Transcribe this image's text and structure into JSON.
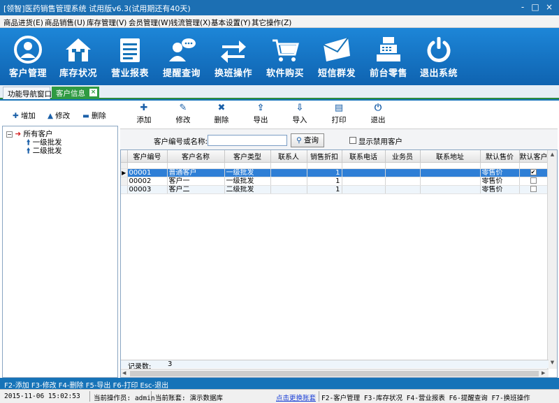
{
  "window": {
    "title": "[领智]医药销售管理系统 试用版v6.3(试用期还有40天)",
    "controls": [
      "-",
      "□",
      "×"
    ]
  },
  "menu": [
    "商品进货(E)",
    "商品销售(U)",
    "库存管理(V)",
    "会员管理(W)",
    "钱流管理(X)",
    "基本设置(Y)",
    "其它操作(Z)"
  ],
  "toolbar": [
    {
      "label": "客户管理",
      "icon": "person-icon"
    },
    {
      "label": "库存状况",
      "icon": "house-icon"
    },
    {
      "label": "营业报表",
      "icon": "report-icon"
    },
    {
      "label": "提醒查询",
      "icon": "chat-user-icon"
    },
    {
      "label": "换班操作",
      "icon": "swap-arrows-icon"
    },
    {
      "label": "软件购买",
      "icon": "cart-icon"
    },
    {
      "label": "短信群发",
      "icon": "envelope-icon"
    },
    {
      "label": "前台零售",
      "icon": "cash-register-icon"
    },
    {
      "label": "退出系统",
      "icon": "power-icon"
    }
  ],
  "tabs": {
    "nav": "功能导航窗口",
    "customer": "客户信息",
    "close": "×"
  },
  "left_actions": {
    "add": "增加",
    "edit": "修改",
    "delete": "删除"
  },
  "tree": {
    "root": "所有客户",
    "children": [
      "一级批发",
      "二级批发"
    ]
  },
  "actions": [
    {
      "label": "添加",
      "icon": "plus-icon",
      "glyph": "✚"
    },
    {
      "label": "修改",
      "icon": "pencil-icon",
      "glyph": "✎"
    },
    {
      "label": "删除",
      "icon": "x-icon",
      "glyph": "✖"
    },
    {
      "label": "导出",
      "icon": "export-icon",
      "glyph": "⇪"
    },
    {
      "label": "导入",
      "icon": "import-icon",
      "glyph": "⇩"
    },
    {
      "label": "打印",
      "icon": "printer-icon",
      "glyph": "▤"
    },
    {
      "label": "退出",
      "icon": "power-icon",
      "glyph": "⏻"
    }
  ],
  "search": {
    "label": "客户编号或名称:",
    "value": "",
    "button": "查询",
    "show_disabled_label": "显示禁用客户",
    "show_disabled_checked": false
  },
  "grid": {
    "columns": [
      "客户编号",
      "客户名称",
      "客户类型",
      "联系人",
      "销售折扣",
      "联系电话",
      "业务员",
      "联系地址",
      "默认售价",
      "默认客户"
    ],
    "rows": [
      {
        "id": "00001",
        "name": "普通客户",
        "type": "一级批发",
        "contact": "",
        "discount": "1",
        "phone": "",
        "salesman": "",
        "address": "",
        "price": "零售价",
        "default": true,
        "selected": true
      },
      {
        "id": "00002",
        "name": "客户一",
        "type": "一级批发",
        "contact": "",
        "discount": "1",
        "phone": "",
        "salesman": "",
        "address": "",
        "price": "零售价",
        "default": false,
        "selected": false
      },
      {
        "id": "00003",
        "name": "客户二",
        "type": "二级批发",
        "contact": "",
        "discount": "1",
        "phone": "",
        "salesman": "",
        "address": "",
        "price": "零售价",
        "default": false,
        "selected": false
      }
    ],
    "footer_label": "记录数:",
    "record_count": "3"
  },
  "hotkeys": "F2-添加 F3-修改 F4-删除 F5-导出 F6-打印 Esc-退出",
  "status": {
    "datetime": "2015-11-06 15:02:53",
    "operator": "当前操作员: admin",
    "account": "当前账套: 演示数据库",
    "switch_account": "点击更换账套",
    "shortcuts": "F2-客户管理 F3-库存状况 F4-营业报表 F6-提醒查询 F7-换班操作"
  },
  "colors": {
    "toolbar_bg": "#1673b8",
    "selected_row": "#2f7fd6",
    "active_tab": "#2f9a42",
    "tree_arrow": "#d42020"
  }
}
